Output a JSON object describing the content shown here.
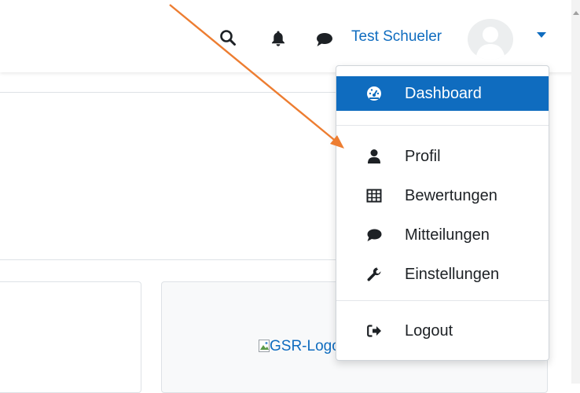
{
  "header": {
    "user_name": "Test Schueler",
    "icons": [
      "search-icon",
      "bell-icon",
      "message-bubble-icon",
      "avatar",
      "caret-down-icon"
    ]
  },
  "user_menu": {
    "items": [
      {
        "label": "Dashboard",
        "icon": "dashboard-gauge-icon",
        "active": true
      },
      {
        "label": "Profil",
        "icon": "user-icon"
      },
      {
        "label": "Bewertungen",
        "icon": "table-grid-icon"
      },
      {
        "label": "Mitteilungen",
        "icon": "speech-bubble-icon"
      },
      {
        "label": "Einstellungen",
        "icon": "wrench-icon"
      },
      {
        "label": "Logout",
        "icon": "sign-out-icon"
      }
    ]
  },
  "content": {
    "image_alt": "GSR-Logo"
  },
  "colors": {
    "accent": "#0f6cbf",
    "annotation_arrow": "#ed7d31"
  }
}
